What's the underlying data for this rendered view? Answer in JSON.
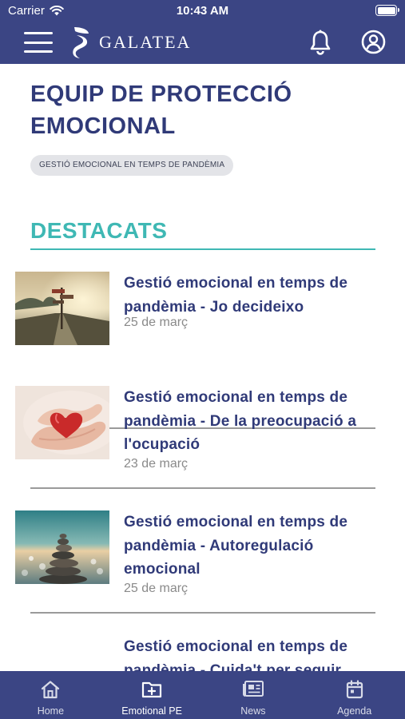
{
  "status_bar": {
    "carrier": "Carrier",
    "time": "10:43 AM"
  },
  "header": {
    "brand": "GALATEA",
    "icons": [
      "menu-icon",
      "logo",
      "bell-icon",
      "user-icon"
    ],
    "color": "#3b4584"
  },
  "page": {
    "title_line1": "EQUIP DE PROTECCIÓ",
    "title_line2": "EMOCIONAL",
    "chip": "GESTIÓ EMOCIONAL EN TEMPS DE PANDÈMIA"
  },
  "section": {
    "title": "DESTACATS",
    "accent": "#3fb8b4"
  },
  "articles": [
    {
      "title_lines": [
        "Gestió emocional en temps de",
        "pandèmia - Jo decideixo"
      ],
      "date": "25 de març",
      "image": "crossroads-signpost-image"
    },
    {
      "title_lines": [
        "Gestió emocional en temps de",
        "pandèmia - De la preocupació a",
        "l'ocupació"
      ],
      "date": "23 de març",
      "image": "hands-holding-heart-image"
    },
    {
      "title_lines": [
        "Gestió emocional en temps de",
        "pandèmia - Autoregulació",
        "emocional"
      ],
      "date": "25 de març",
      "image": "stacked-stones-image"
    },
    {
      "title_lines": [
        "Gestió emocional en temps de",
        "pandèmia - Cuida't per seguir"
      ],
      "date": "",
      "image": ""
    }
  ],
  "tabbar": {
    "tabs": [
      {
        "label": "Home",
        "icon": "home-icon",
        "active": false
      },
      {
        "label": "Emotional PE",
        "icon": "folder-plus-icon",
        "active": true
      },
      {
        "label": "News",
        "icon": "newspaper-icon",
        "active": false
      },
      {
        "label": "Agenda",
        "icon": "calendar-icon",
        "active": false
      }
    ]
  }
}
